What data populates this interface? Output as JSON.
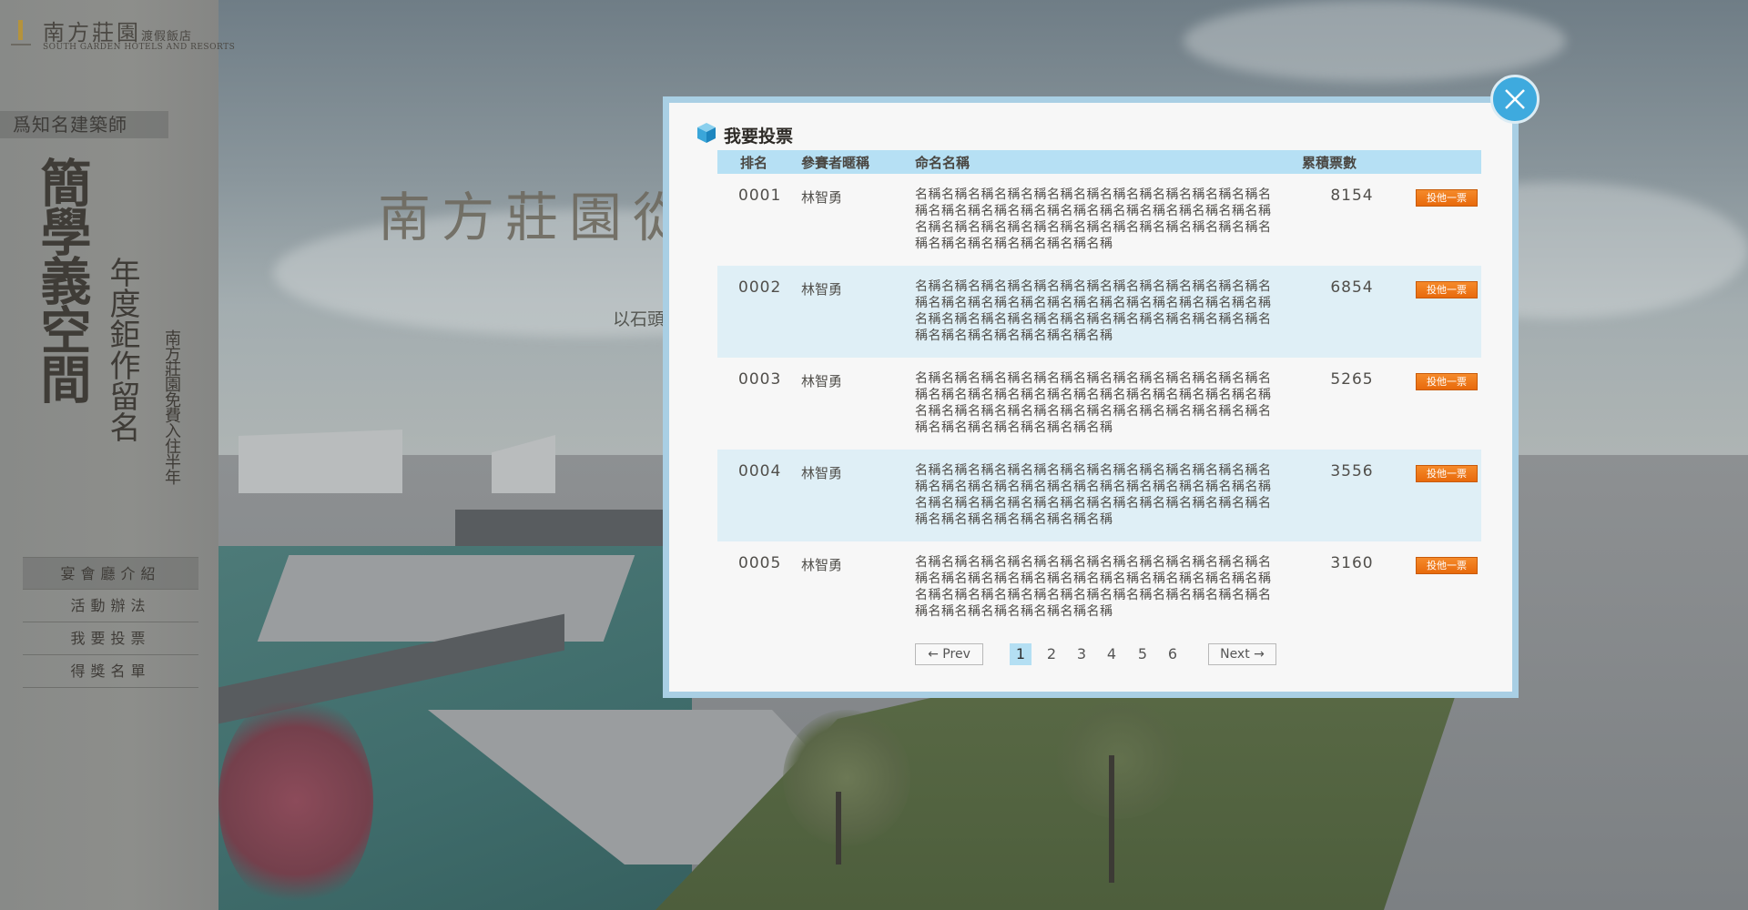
{
  "brand": {
    "name_cn": "南方莊園",
    "name_suffix": "渡假飯店",
    "name_en": "SOUTH GARDEN HOTELS AND RESORTS"
  },
  "sidebar": {
    "banner": "爲知名建築師",
    "vertical_big": "簡學義空間",
    "vertical_mid": "年度鉅作留名",
    "vertical_small": "南方莊園免費入住半年",
    "nav": [
      {
        "label": "宴會廳介紹"
      },
      {
        "label": "活動辦法"
      },
      {
        "label": "我要投票"
      },
      {
        "label": "得獎名單"
      }
    ]
  },
  "background": {
    "title": "南方莊園從",
    "subtitle": "以石頭"
  },
  "modal": {
    "title": "我要投票",
    "icon": "cube-icon",
    "columns": {
      "rank": "排名",
      "participant": "參賽者暱稱",
      "entry_name": "命名名稱",
      "votes": "累積票數"
    },
    "rows": [
      {
        "rank": "0001",
        "participant": "林智勇",
        "entry_name": "名稱名稱名稱名稱名稱名稱名稱名稱名稱名稱名稱名稱名稱名稱名稱名稱名稱名稱名稱名稱名稱名稱名稱名稱名稱名稱名稱名稱名稱名稱名稱名稱名稱名稱名稱名稱名稱名稱名稱名稱名稱名稱名稱名稱名稱名稱名稱名稱",
        "votes": "8154",
        "vote_label": "投他一票"
      },
      {
        "rank": "0002",
        "participant": "林智勇",
        "entry_name": "名稱名稱名稱名稱名稱名稱名稱名稱名稱名稱名稱名稱名稱名稱名稱名稱名稱名稱名稱名稱名稱名稱名稱名稱名稱名稱名稱名稱名稱名稱名稱名稱名稱名稱名稱名稱名稱名稱名稱名稱名稱名稱名稱名稱名稱名稱名稱名稱",
        "votes": "6854",
        "vote_label": "投他一票"
      },
      {
        "rank": "0003",
        "participant": "林智勇",
        "entry_name": "名稱名稱名稱名稱名稱名稱名稱名稱名稱名稱名稱名稱名稱名稱名稱名稱名稱名稱名稱名稱名稱名稱名稱名稱名稱名稱名稱名稱名稱名稱名稱名稱名稱名稱名稱名稱名稱名稱名稱名稱名稱名稱名稱名稱名稱名稱名稱名稱",
        "votes": "5265",
        "vote_label": "投他一票"
      },
      {
        "rank": "0004",
        "participant": "林智勇",
        "entry_name": "名稱名稱名稱名稱名稱名稱名稱名稱名稱名稱名稱名稱名稱名稱名稱名稱名稱名稱名稱名稱名稱名稱名稱名稱名稱名稱名稱名稱名稱名稱名稱名稱名稱名稱名稱名稱名稱名稱名稱名稱名稱名稱名稱名稱名稱名稱名稱名稱",
        "votes": "3556",
        "vote_label": "投他一票"
      },
      {
        "rank": "0005",
        "participant": "林智勇",
        "entry_name": "名稱名稱名稱名稱名稱名稱名稱名稱名稱名稱名稱名稱名稱名稱名稱名稱名稱名稱名稱名稱名稱名稱名稱名稱名稱名稱名稱名稱名稱名稱名稱名稱名稱名稱名稱名稱名稱名稱名稱名稱名稱名稱名稱名稱名稱名稱名稱名稱",
        "votes": "3160",
        "vote_label": "投他一票"
      }
    ],
    "pagination": {
      "prev": "← Prev",
      "next": "Next →",
      "pages": [
        "1",
        "2",
        "3",
        "4",
        "5",
        "6"
      ],
      "current": "1"
    }
  },
  "colors": {
    "modal_frame": "#a9cfe4",
    "header_bg": "#b6e0f4",
    "alt_row": "#dfeff6",
    "vote_button": "#e86a0c",
    "close_button": "#3eaade"
  }
}
